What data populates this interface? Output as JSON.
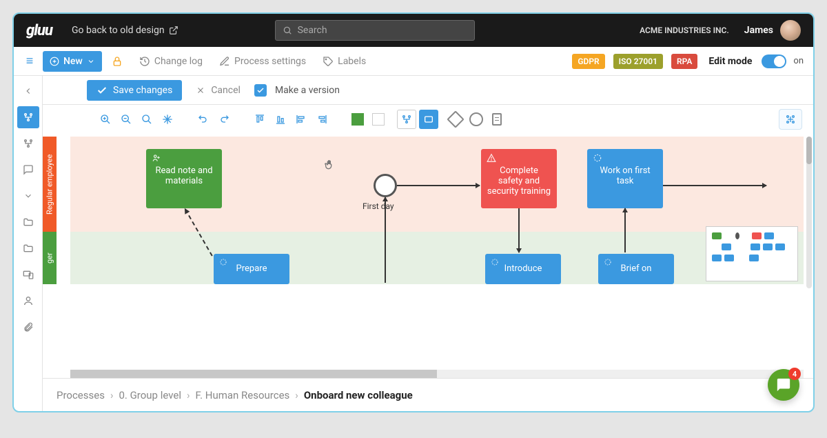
{
  "header": {
    "logo": "gluu",
    "old_design": "Go back to old design",
    "search_placeholder": "Search",
    "company": "ACME INDUSTRIES INC.",
    "user": "James"
  },
  "toolbar1": {
    "new_label": "New",
    "changelog": "Change log",
    "process_settings": "Process settings",
    "labels": "Labels",
    "badges": {
      "gdpr": "GDPR",
      "iso": "ISO 27001",
      "rpa": "RPA"
    },
    "edit_mode_label": "Edit mode",
    "toggle_state": "on"
  },
  "actionbar": {
    "save": "Save changes",
    "cancel": "Cancel",
    "make_version": "Make a version"
  },
  "lanes": {
    "lane1": "Regular employee",
    "lane2": "ger"
  },
  "nodes": {
    "read_note": "Read note and materials",
    "first_day": "First day",
    "safety": "Complete safety and security training",
    "first_task": "Work on first task",
    "prepare": "Prepare",
    "introduce": "Introduce",
    "brief_on": "Brief on"
  },
  "breadcrumb": {
    "items": [
      "Processes",
      "0. Group level",
      "F. Human Resources",
      "Onboard new colleague"
    ]
  },
  "chat": {
    "count": "4"
  }
}
